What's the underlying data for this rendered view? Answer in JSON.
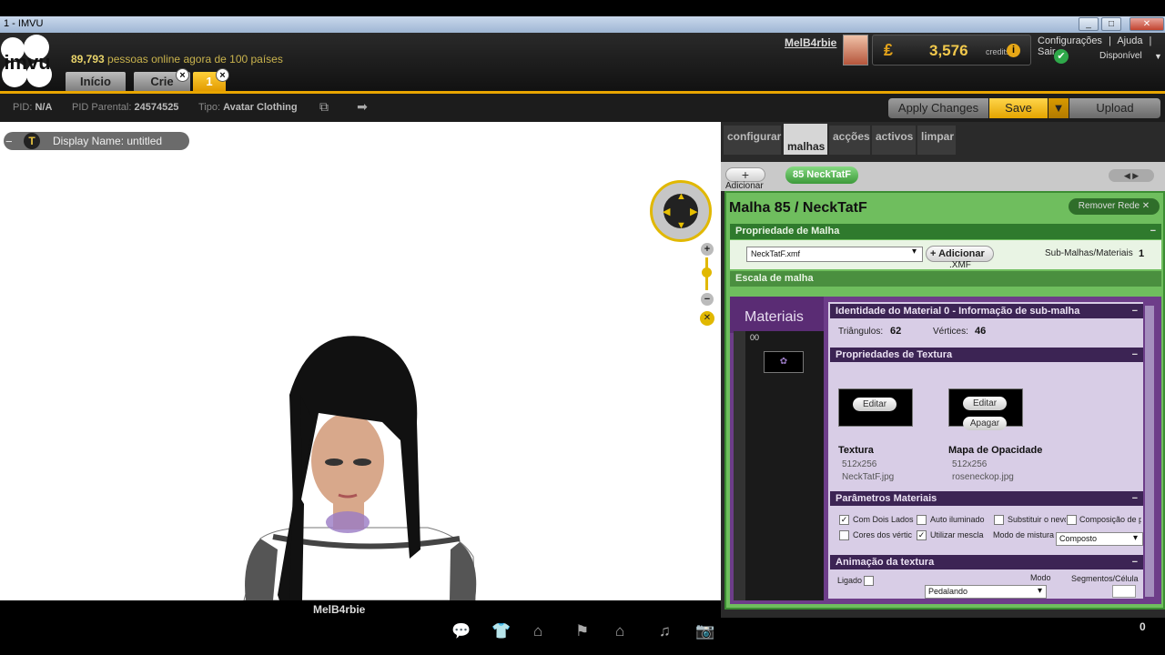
{
  "window": {
    "title": "1 - IMVU",
    "minimize": "_",
    "maximize": "□",
    "close": "✕"
  },
  "header": {
    "logo_text": "imvu",
    "online_count": "89,793",
    "online_text": "pessoas online agora de 100 países",
    "tabs": [
      {
        "label": "Início"
      },
      {
        "label": "Crie"
      },
      {
        "label": "1"
      }
    ],
    "tab_close": "×",
    "username": "MelB4rbie",
    "credits_symbol": "₤",
    "credits_value": "3,576",
    "credits_label": "credits",
    "credits_info": "i",
    "links": [
      "Configurações",
      "|",
      "Ajuda",
      "|",
      "Sair"
    ],
    "status": "Disponível",
    "status_check": "✔",
    "status_arrow": "▼"
  },
  "infobar": {
    "pid_label": "PID:",
    "pid_value": "N/A",
    "parent_label": "PID Parental:",
    "parent_value": "24574525",
    "type_label": "Tipo:",
    "type_value": "Avatar Clothing",
    "icon1": "⧉",
    "icon2": "➡"
  },
  "actions": {
    "apply": "Apply Changes",
    "save": "Save",
    "save_menu": "▼",
    "upload": "Upload"
  },
  "viewport": {
    "display_name": "Display Name: untitled",
    "display_minus": "−",
    "display_icon": "T",
    "avatar_name": "MelB4rbie",
    "dpad": {
      "up": "▲",
      "down": "▼",
      "left": "◀",
      "right": "▶"
    },
    "zoom_plus": "+",
    "zoom_minus": "−",
    "reset": "✕"
  },
  "bottombar": {
    "icons": [
      "💬",
      "👕",
      "⌂",
      "⚑",
      "⌂",
      "♫",
      "📷"
    ],
    "right_number": "0"
  },
  "panel": {
    "tabs": [
      {
        "label": "configurar"
      },
      {
        "label": "malhas"
      },
      {
        "label": "acções"
      },
      {
        "label": "activos"
      },
      {
        "label": "limpar"
      }
    ],
    "add_symbol": "+",
    "add_label": "Adicionar",
    "mesh_pill": "85 NeckTatF",
    "nav_arrows": "◀ ▶",
    "mesh_title": "Malha 85 / NeckTatF",
    "remove_btn": "Remover Rede ✕",
    "prop_heading": "Propriedade de Malha",
    "mesh_file": "NeckTatF.xmf",
    "mesh_add": "+ Adicionar",
    "xmf_label": ".XMF",
    "submesh_label": "Sub-Malhas/Materiais",
    "submesh_value": "1",
    "scale_heading": "Escala de malha",
    "materials_heading": "Materiais",
    "material_item": "00",
    "material_thumb": "✿",
    "identity_heading": "Identidade do Material 0 - Informação de sub-malha",
    "triangles_label": "Triângulos:",
    "triangles_value": "62",
    "vertices_label": "Vértices:",
    "vertices_value": "46",
    "texture_heading": "Propriedades de Textura",
    "edit": "Editar",
    "delete": "Apagar",
    "texture_label": "Textura",
    "texture_size": "512x256",
    "texture_file": "NeckTatF.jpg",
    "opacity_label": "Mapa de Opacidade",
    "opacity_size": "512x256",
    "opacity_file": "roseneckop.jpg",
    "params_heading": "Parâmetros Materiais",
    "params": {
      "two_sided": "Com Dois Lados",
      "auto_lit": "Auto iluminado",
      "replace_fog": "Substituir o nevo",
      "composition": "Composição de p",
      "vertex_colors": "Cores dos vértic",
      "use_blend": "Utilizar mescla",
      "blend_mode_label": "Modo de mistura",
      "blend_mode_value": "Composto"
    },
    "anim_heading": "Animação da textura",
    "anim": {
      "on_label": "Ligado",
      "mode_label": "Modo",
      "segments_label": "Segmentos/Célula",
      "mode_value": "Pedalando"
    },
    "collapse": "−",
    "select_arrow": "▾",
    "check": "✓"
  }
}
